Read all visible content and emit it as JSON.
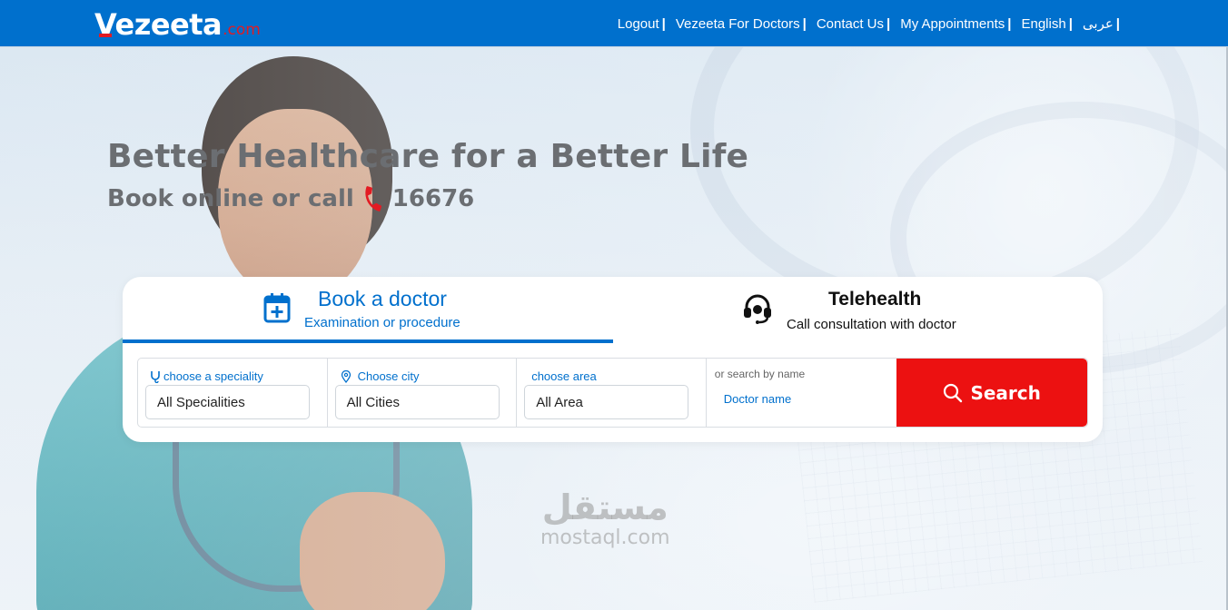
{
  "brand": {
    "name": "Vezeeta",
    "suffix": ".com",
    "colors": {
      "primary": "#0070cd",
      "accent": "#e31b23",
      "search_button": "#ec1111"
    }
  },
  "nav": {
    "links": [
      {
        "label": "Logout"
      },
      {
        "label": "Vezeeta For Doctors"
      },
      {
        "label": "Contact Us"
      },
      {
        "label": "My Appointments"
      },
      {
        "label": "English"
      },
      {
        "label": "عربى"
      }
    ],
    "separator": "|"
  },
  "hero": {
    "title": "Better Healthcare for a Better Life",
    "subtitle_prefix": "Book online or call",
    "phone_icon": "phone-icon",
    "phone_number": "16676"
  },
  "booking": {
    "tabs": [
      {
        "title": "Book a doctor",
        "desc": "Examination or procedure",
        "icon": "calendar-plus-icon",
        "active": true
      },
      {
        "title": "Telehealth",
        "desc": "Call consultation with doctor",
        "icon": "headset-icon",
        "active": false
      }
    ],
    "filters": {
      "speciality": {
        "label": "choose a speciality",
        "value": "All Specialities",
        "icon": "stethoscope-icon"
      },
      "city": {
        "label": "Choose city",
        "value": "All Cities",
        "icon": "location-pin-icon"
      },
      "area": {
        "label": "choose area",
        "value": "All Area"
      },
      "name": {
        "label": "or search by name",
        "placeholder": "Doctor name"
      }
    },
    "search_label": "Search",
    "search_icon": "magnifier-icon"
  },
  "watermark": {
    "arabic": "مستقل",
    "english": "mostaql.com"
  }
}
